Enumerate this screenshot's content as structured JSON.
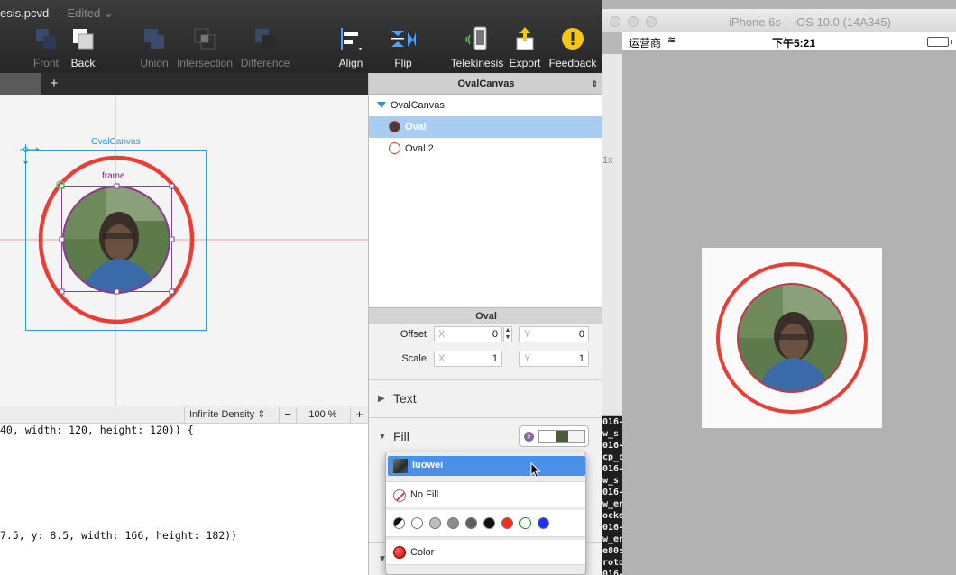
{
  "document": {
    "title": "esis.pcvd",
    "edited": "— Edited ⌄"
  },
  "toolbar": {
    "front": "Front",
    "back": "Back",
    "union": "Union",
    "intersection": "Intersection",
    "difference": "Difference",
    "align": "Align",
    "flip": "Flip",
    "telekinesis": "Telekinesis",
    "export": "Export",
    "feedback": "Feedback"
  },
  "tabs": {
    "add": "+"
  },
  "canvas": {
    "ovalcanvas_label": "OvalCanvas",
    "frame_label": "frame"
  },
  "statusbar": {
    "density": "Infinite Density",
    "density_arrows": "⇕",
    "zoom_minus": "−",
    "zoom": "100 %",
    "zoom_plus": "+"
  },
  "code": {
    "line1": "40, width: 120, height: 120)) {",
    "line2": "7.5, y: 8.5, width: 166, height: 182))"
  },
  "inspector": {
    "header": "OvalCanvas",
    "header_arrows": "⇕",
    "layers": [
      {
        "name": "OvalCanvas"
      },
      {
        "name": "Oval"
      },
      {
        "name": "Oval 2"
      }
    ],
    "section_oval": "Oval",
    "offset_label": "Offset",
    "scale_label": "Scale",
    "offset_x_ph": "X",
    "offset_x": "0",
    "offset_y_ph": "Y",
    "offset_y": "0",
    "scale_x_ph": "X",
    "scale_x": "1",
    "scale_y_ph": "Y",
    "scale_y": "1",
    "text_section": "Text",
    "fill_section": "Fill",
    "fill_clear": "×"
  },
  "fill_popup": {
    "image_option": "luowei",
    "no_fill": "No Fill",
    "color": "Color",
    "swatches": [
      "#ffffff",
      "#bdbdbd",
      "#8c8c8c",
      "#5f5f5f",
      "#111111",
      "#ff2a1a",
      "#ffffff",
      "#1a33ff"
    ]
  },
  "simulator": {
    "title": "iPhone 6s – iOS 10.0 (14A345)",
    "carrier": "运营商",
    "wifi": "≋",
    "time": "下午5:21",
    "battery_level": 1.0
  },
  "behind": {
    "scale_hint": "1x"
  },
  "terminal": {
    "lines": [
      "016-",
      "w_s",
      "016-",
      "cp_c",
      "016-",
      "w_s",
      "016-",
      "w_er",
      "ocke",
      "016-",
      "w_er",
      "e80:",
      "roto",
      "016-"
    ]
  },
  "colors": {
    "accent_red": "#e53a2f",
    "selection_blue": "#a8cdf0",
    "menu_highlight": "#4a90e8",
    "frame_blue": "#2a9bd6"
  }
}
